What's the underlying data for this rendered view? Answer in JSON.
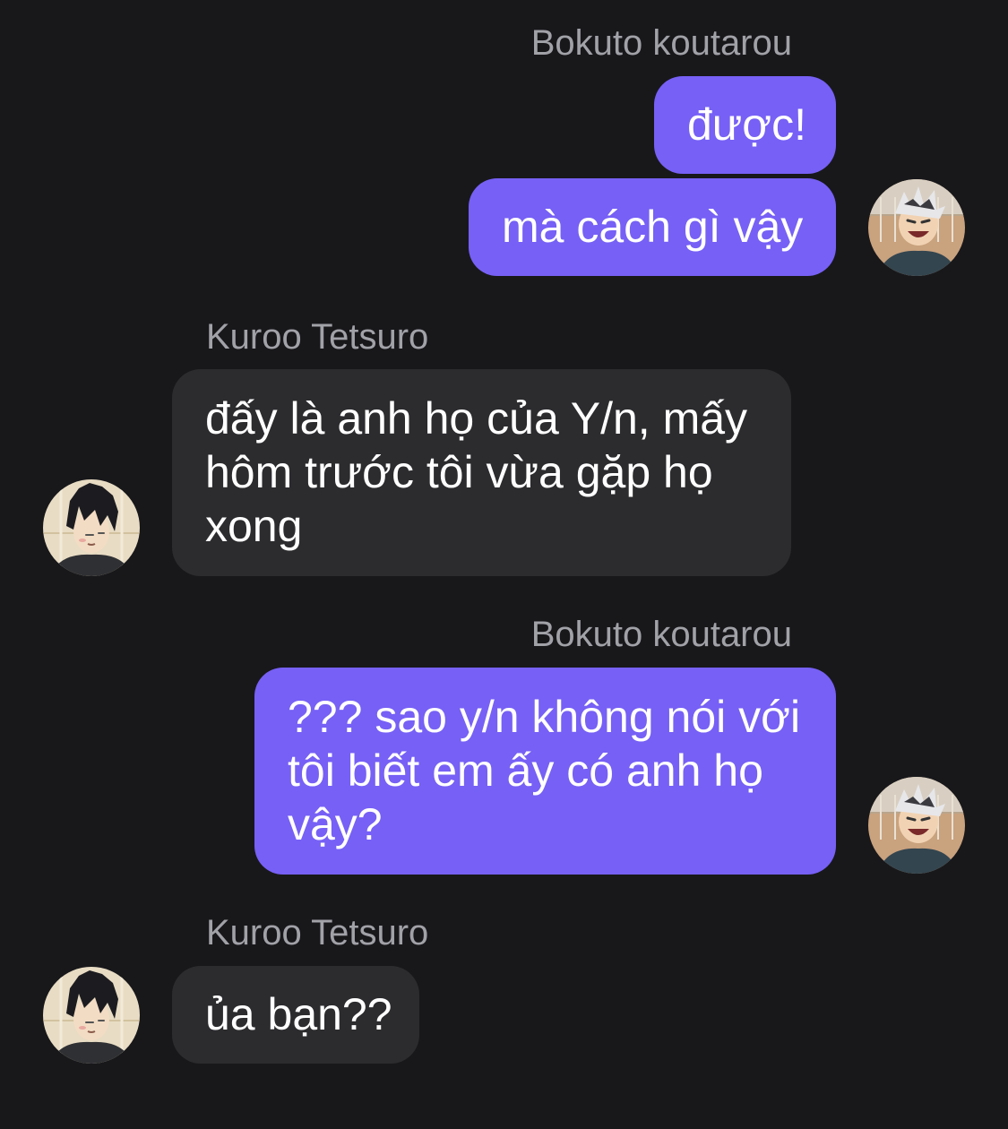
{
  "messages": [
    {
      "sender": "Bokuto koutarou",
      "side": "outgoing",
      "avatar_icon": "bokuto-avatar-icon",
      "bubbles": [
        {
          "lines": [
            "được!"
          ]
        },
        {
          "lines": [
            "mà cách gì vậy"
          ]
        }
      ]
    },
    {
      "sender": "Kuroo Tetsuro",
      "side": "incoming",
      "avatar_icon": "kuroo-avatar-icon",
      "bubbles": [
        {
          "lines": [
            "đấy là anh họ của Y/n, mấy",
            "hôm trước tôi vừa gặp họ",
            "xong"
          ]
        }
      ]
    },
    {
      "sender": "Bokuto koutarou",
      "side": "outgoing",
      "avatar_icon": "bokuto-avatar-icon",
      "bubbles": [
        {
          "lines": [
            "??? sao y/n không nói với",
            "tôi biết em ấy có anh họ",
            "vậy?"
          ]
        }
      ]
    },
    {
      "sender": "Kuroo Tetsuro",
      "side": "incoming",
      "avatar_icon": "kuroo-avatar-icon",
      "bubbles": [
        {
          "lines": [
            "ủa bạn??"
          ]
        }
      ]
    }
  ],
  "colors": {
    "background": "#18181b",
    "outgoing_bubble": "#7660f5",
    "incoming_bubble": "#2c2c2f",
    "sender_name": "#a1a1a8",
    "message_text": "#ffffff"
  }
}
